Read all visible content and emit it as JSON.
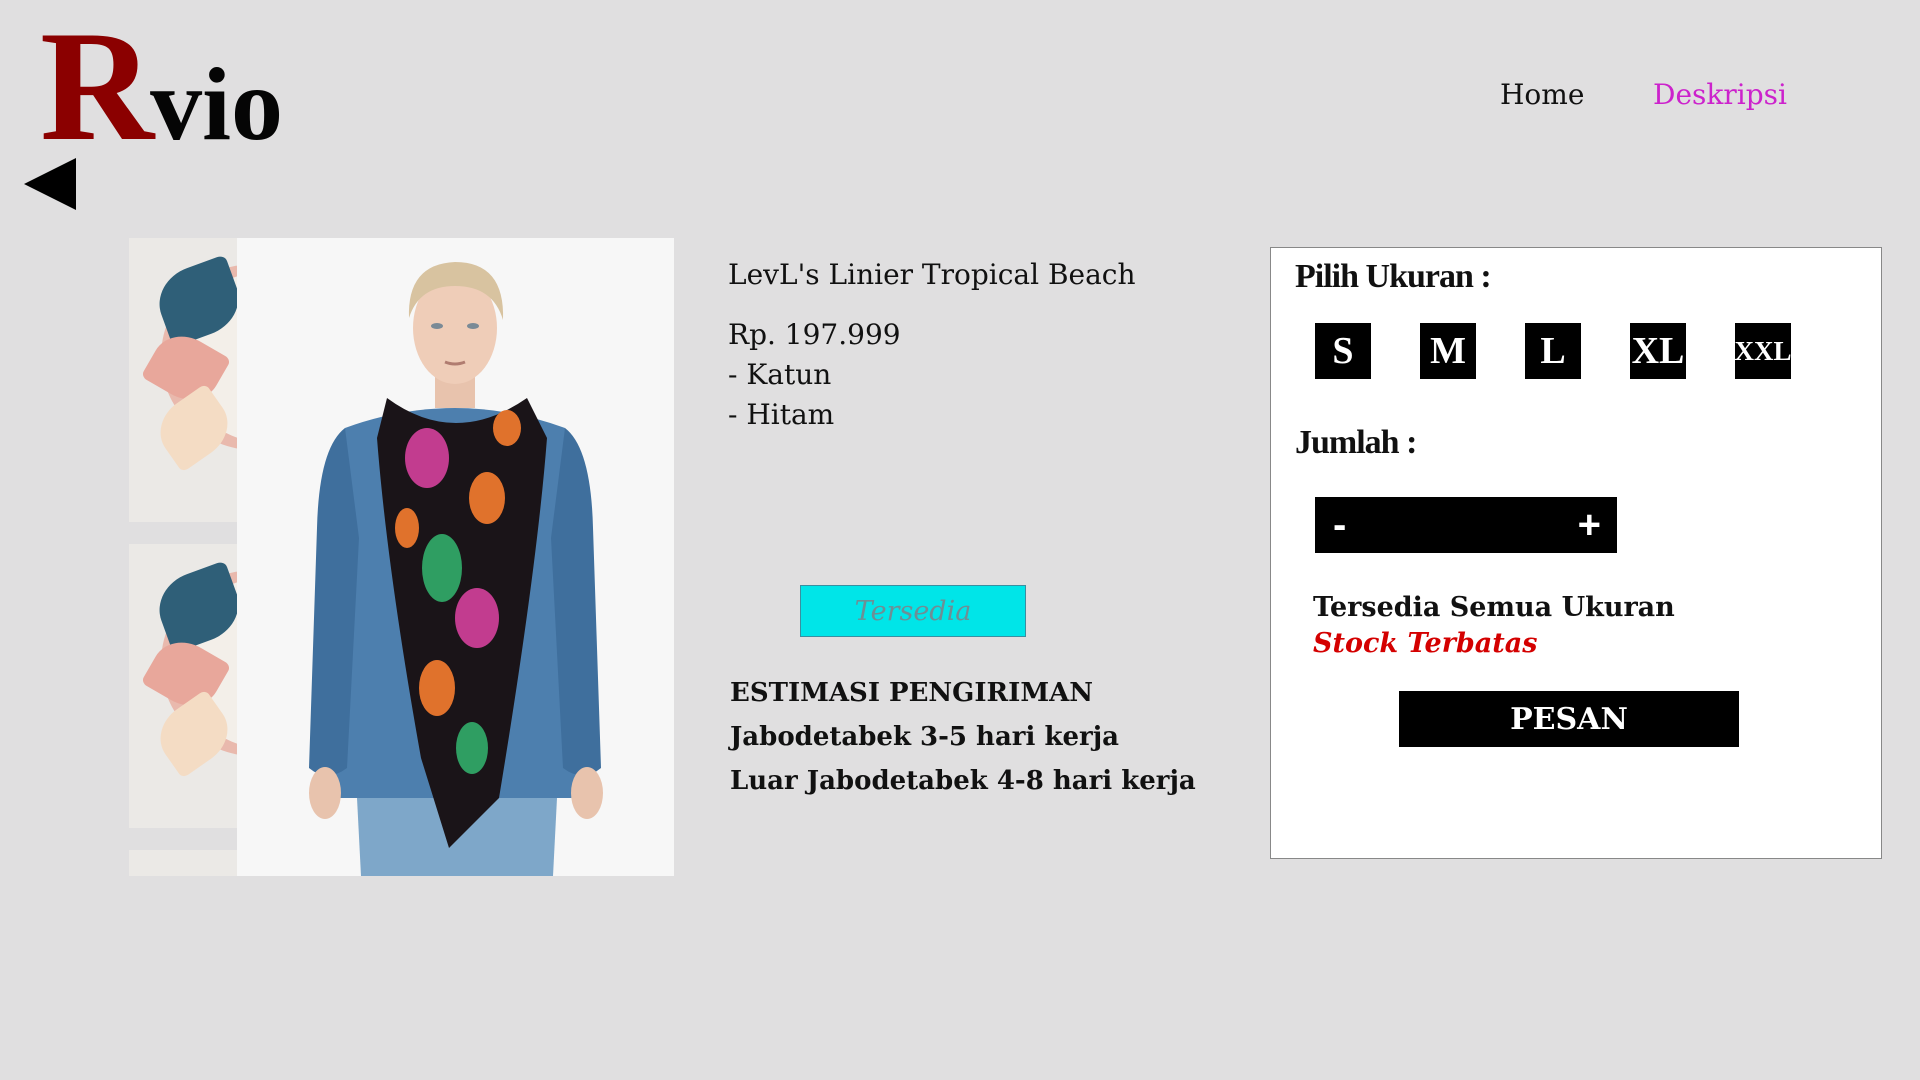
{
  "brand": {
    "initial": "R",
    "rest": "vio"
  },
  "nav": {
    "home": "Home",
    "description": "Deskripsi"
  },
  "product": {
    "title": "LevL's Linier Tropical Beach",
    "price": "Rp. 197.999",
    "specs": [
      "- Katun",
      "- Hitam"
    ],
    "availability_badge": "Tersedia"
  },
  "shipping": {
    "heading": "ESTIMASI PENGIRIMAN",
    "lines": [
      "Jabodetabek 3-5 hari kerja",
      "Luar Jabodetabek 4-8 hari kerja"
    ]
  },
  "order_panel": {
    "size_heading": "Pilih Ukuran :",
    "sizes": [
      "S",
      "M",
      "L",
      "XL",
      "XXL"
    ],
    "quantity_heading": "Jumlah :",
    "minus_label": "-",
    "plus_label": "+",
    "availability_note": "Tersedia Semua Ukuran",
    "stock_note": "Stock Terbatas",
    "order_button": "PESAN"
  },
  "icons": {
    "back": "back-triangle-icon"
  },
  "colors": {
    "background": "#e0dfe0",
    "logo_initial": "#8b0000",
    "nav_active": "#cc22cc",
    "badge": "#00e5e8",
    "stock_warning": "#d40000"
  }
}
